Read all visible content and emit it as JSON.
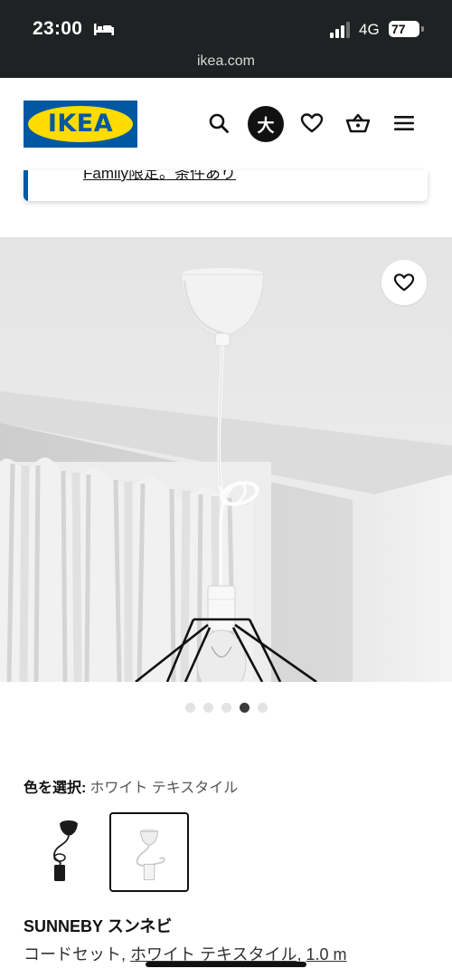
{
  "status_bar": {
    "time": "23:00",
    "network": "4G",
    "battery": "77",
    "url": "ikea.com"
  },
  "header": {
    "logo_text": "IKEA",
    "size_button_label": "大",
    "icons": [
      "search-icon",
      "heart-icon",
      "basket-icon",
      "menu-icon"
    ]
  },
  "banner": {
    "text": "Family限定。条件あり"
  },
  "gallery": {
    "dot_count": 5,
    "active_index": 3
  },
  "color": {
    "label": "色を選択:",
    "selected_value": "ホワイト テキスタイル",
    "options": [
      "black",
      "white"
    ],
    "selected_index": 1
  },
  "product": {
    "name": "SUNNEBY スンネビ",
    "desc_prefix": "コードセット, ",
    "desc_color": "ホワイト テキスタイル",
    "desc_sep": ", ",
    "desc_length": "1.0 m"
  },
  "colors": {
    "ikea_blue": "#0058a3",
    "ikea_yellow": "#ffdb00",
    "status_bar_bg": "#1f2223"
  }
}
